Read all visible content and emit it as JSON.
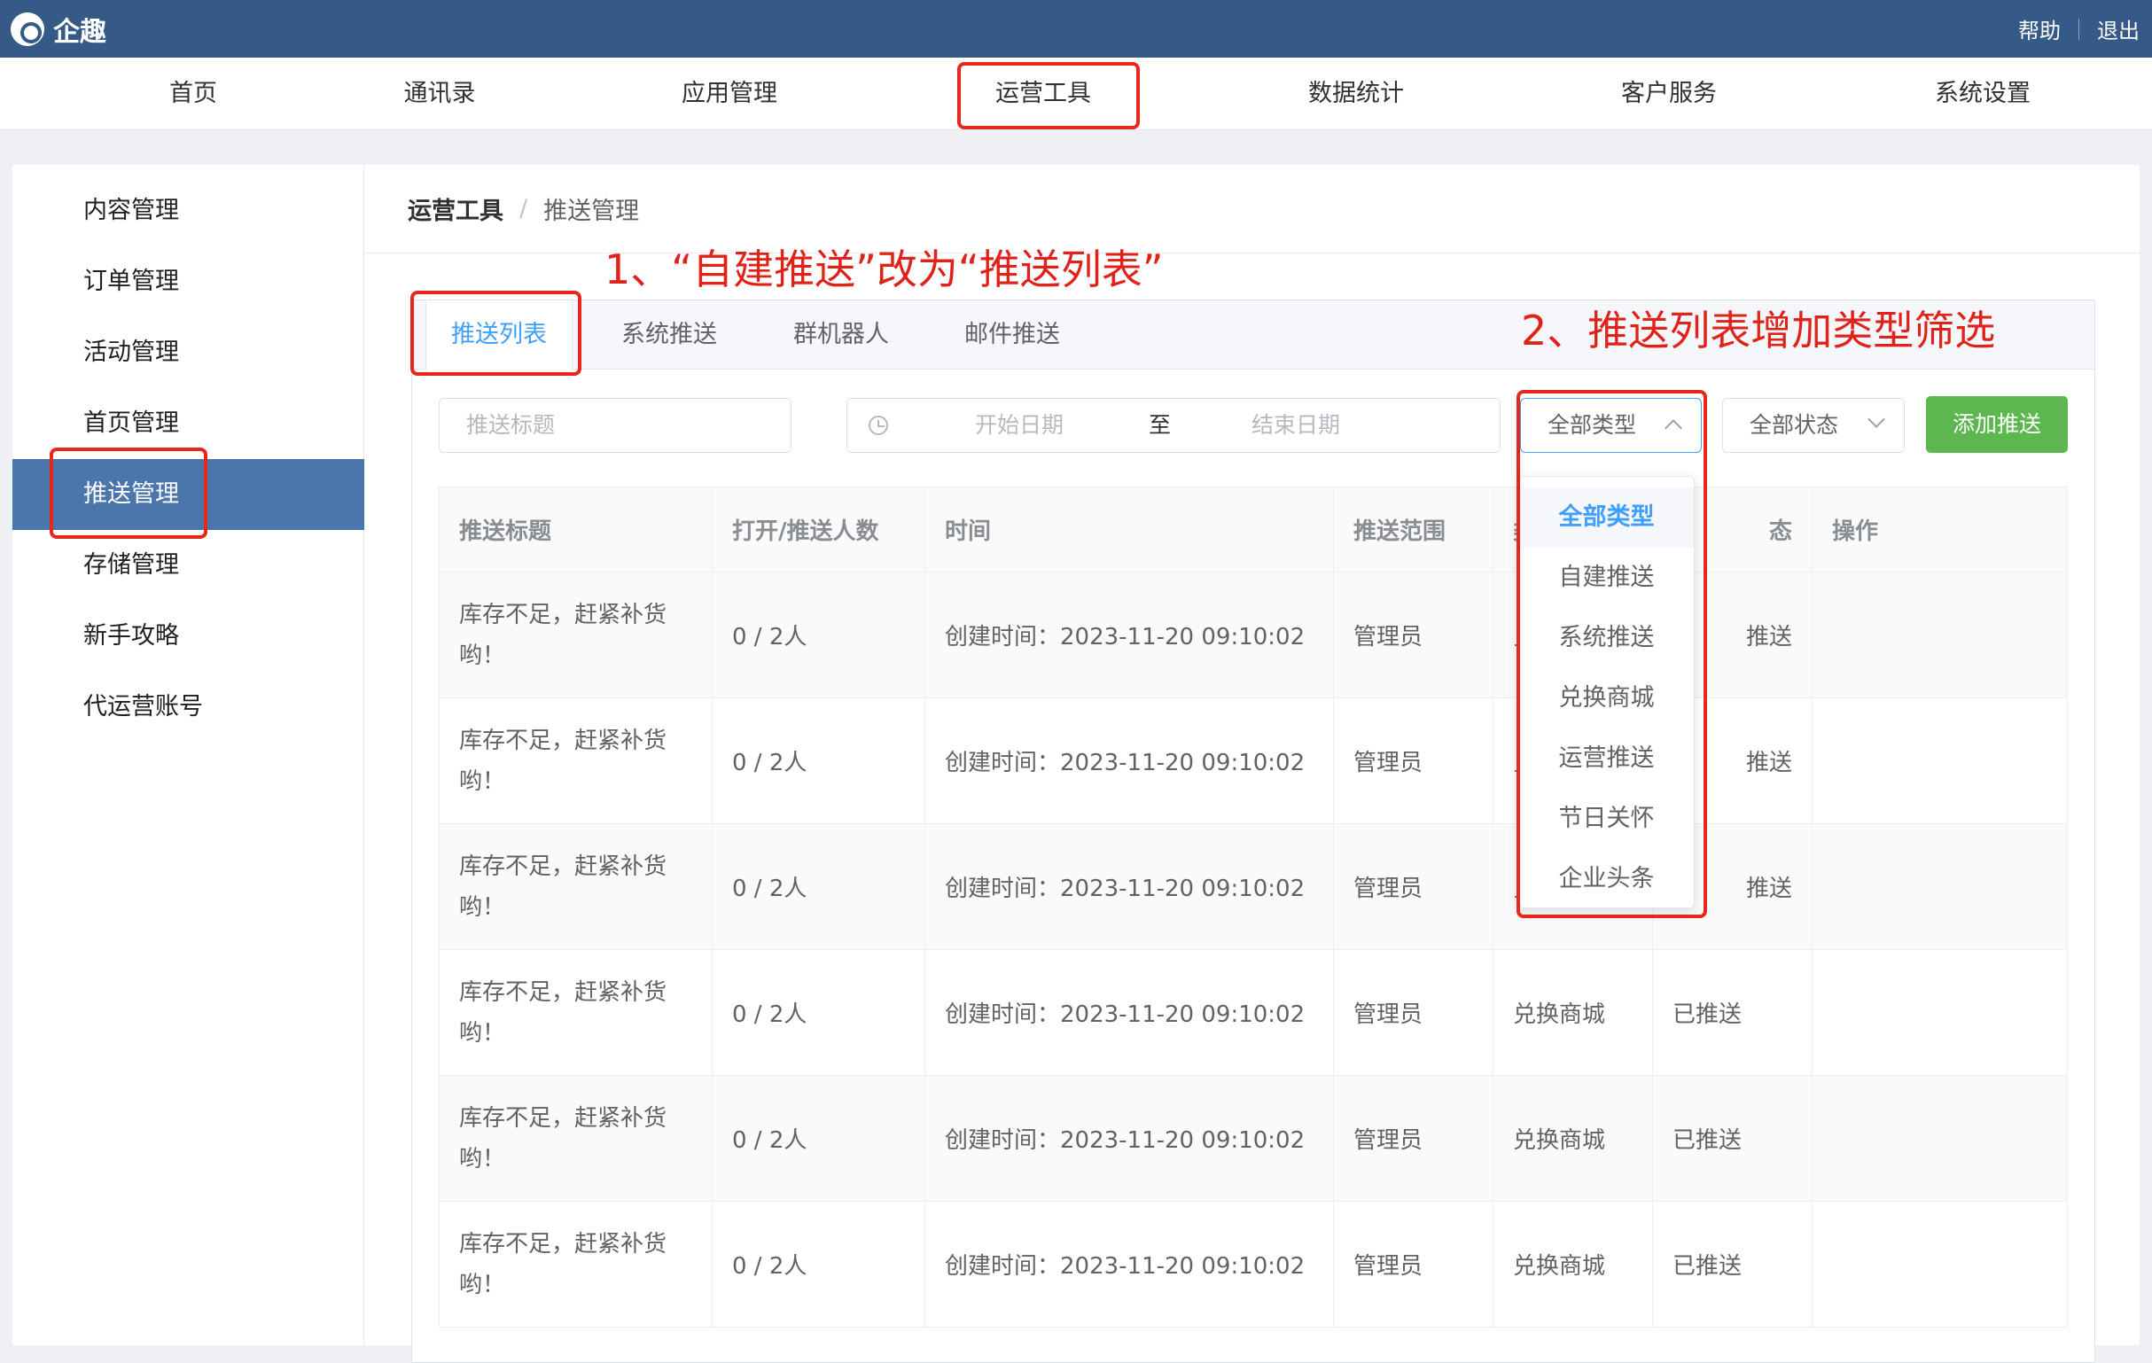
{
  "app": {
    "name": "企趣",
    "help": "帮助",
    "logout": "退出"
  },
  "nav": [
    "首页",
    "通讯录",
    "应用管理",
    "运营工具",
    "数据统计",
    "客户服务",
    "系统设置"
  ],
  "sidebar": [
    "内容管理",
    "订单管理",
    "活动管理",
    "首页管理",
    "推送管理",
    "存储管理",
    "新手攻略",
    "代运营账号"
  ],
  "breadcrumb": {
    "parent": "运营工具",
    "separator": "/",
    "current": "推送管理"
  },
  "tabs": [
    "推送列表",
    "系统推送",
    "群机器人",
    "邮件推送"
  ],
  "filters": {
    "title_placeholder": "推送标题",
    "start_placeholder": "开始日期",
    "range_sep": "至",
    "end_placeholder": "结束日期",
    "type_select": "全部类型",
    "status_select": "全部状态",
    "add_button": "添加推送"
  },
  "type_options": [
    "全部类型",
    "自建推送",
    "系统推送",
    "兑换商城",
    "运营推送",
    "节日关怀",
    "企业头条"
  ],
  "table": {
    "columns": [
      "推送标题",
      "打开/推送人数",
      "时间",
      "推送范围",
      "",
      "",
      "操作"
    ],
    "col_status_tail": "态",
    "col_type_head": "类",
    "rows": [
      [
        "库存不足，赶紧补货哟！",
        "0 / 2人",
        "创建时间：2023-11-20 09:10:02",
        "管理员",
        "兑",
        "推送",
        ""
      ],
      [
        "库存不足，赶紧补货哟！",
        "0 / 2人",
        "创建时间：2023-11-20 09:10:02",
        "管理员",
        "兑",
        "推送",
        ""
      ],
      [
        "库存不足，赶紧补货哟！",
        "0 / 2人",
        "创建时间：2023-11-20 09:10:02",
        "管理员",
        "兑",
        "推送",
        ""
      ],
      [
        "库存不足，赶紧补货哟！",
        "0 / 2人",
        "创建时间：2023-11-20 09:10:02",
        "管理员",
        "兑换商城",
        "已推送",
        ""
      ],
      [
        "库存不足，赶紧补货哟！",
        "0 / 2人",
        "创建时间：2023-11-20 09:10:02",
        "管理员",
        "兑换商城",
        "已推送",
        ""
      ],
      [
        "库存不足，赶紧补货哟！",
        "0 / 2人",
        "创建时间：2023-11-20 09:10:02",
        "管理员",
        "兑换商城",
        "已推送",
        ""
      ]
    ]
  },
  "annotations": {
    "note1": "1、“自建推送”改为“推送列表”",
    "note2": "2、推送列表增加类型筛选"
  },
  "colors": {
    "topbar": "#355a87",
    "active_side": "#4a76ac",
    "accent": "#409eff",
    "add_button": "#5cb84e",
    "annotation": "#e8261c"
  }
}
